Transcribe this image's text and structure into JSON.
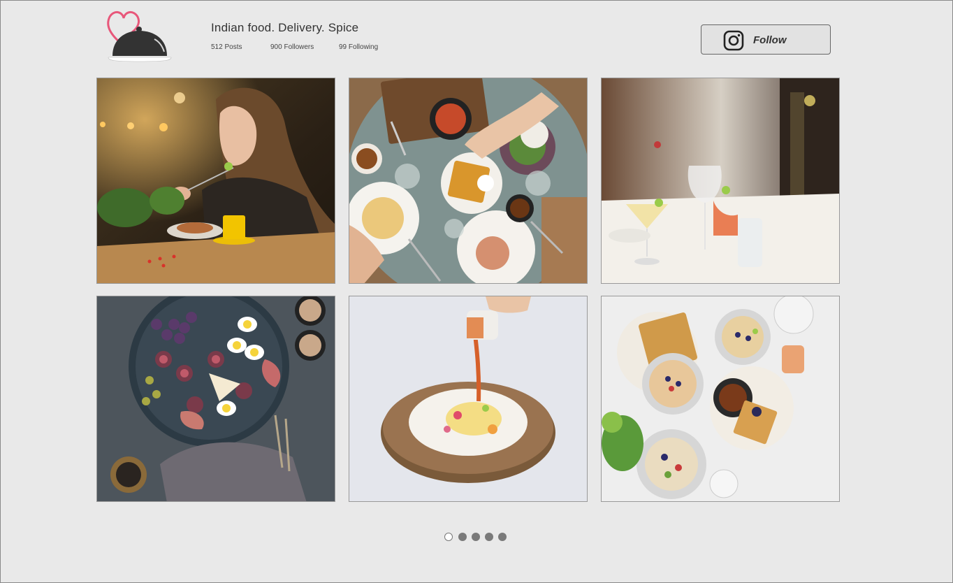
{
  "profile": {
    "name": "Indian food. Delivery. Spice",
    "posts": "512 Posts",
    "followers": "900 Followers",
    "following": "99 Following"
  },
  "follow_button": {
    "label": "Follow",
    "icon": "instagram-icon"
  },
  "logo": {
    "icon": "heart-cloche-logo",
    "heart_color": "#e8577a",
    "cloche_color": "#333333"
  },
  "gallery": {
    "photos": [
      {
        "name": "woman-eating-cafe"
      },
      {
        "name": "brunch-table-top-view"
      },
      {
        "name": "cocktails-restaurant-table"
      },
      {
        "name": "figs-eggs-platter"
      },
      {
        "name": "pouring-sauce-bowl"
      },
      {
        "name": "breakfast-bowls-waffles"
      }
    ]
  },
  "pagination": {
    "pages": 5,
    "current": 1
  }
}
